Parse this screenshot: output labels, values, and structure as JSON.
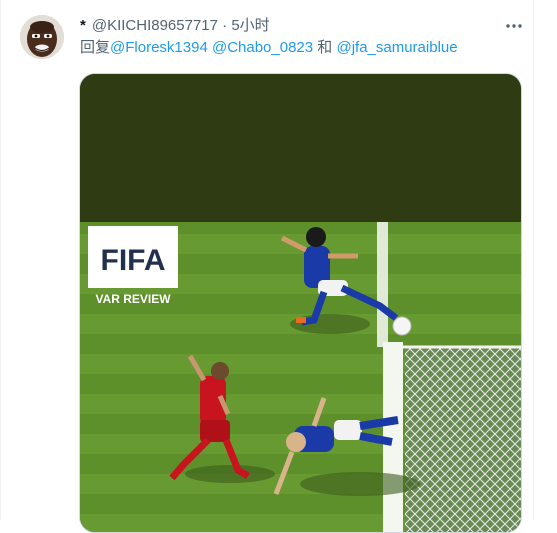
{
  "tweet": {
    "author_name": "*",
    "author_handle": "@KIICHI89657717",
    "separator": "·",
    "time": "5小时",
    "reply_prefix": "回复",
    "mentions": [
      "@Floresk1394",
      "@Chabo_0823",
      "@jfa_samuraiblue"
    ],
    "mention_joiner": "和"
  },
  "media": {
    "logo_text": "FIFA",
    "caption": "VAR REVIEW"
  },
  "icons": {
    "more": "more-horizontal-icon",
    "avatar": "user-avatar-image"
  },
  "colors": {
    "mention": "#1d9bf0",
    "meta": "#536471",
    "pitch": "#5a8a2a",
    "media_top": "#2f3b12"
  }
}
